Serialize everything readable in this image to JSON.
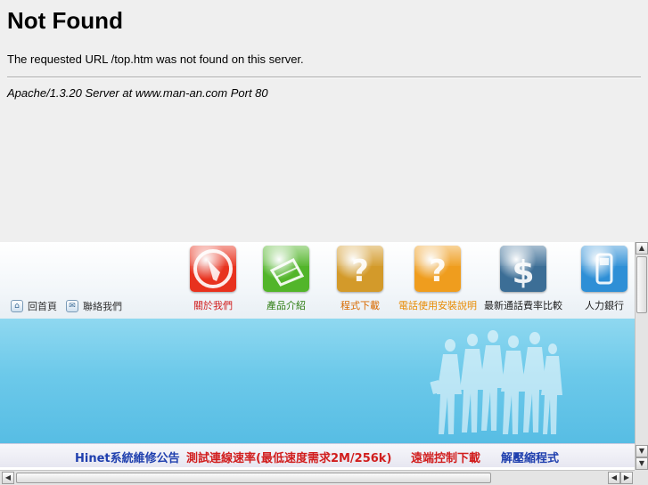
{
  "error_page": {
    "heading": "Not Found",
    "message": "The requested URL /top.htm was not found on this server.",
    "server_signature": "Apache/1.3.20 Server at www.man-an.com Port 80"
  },
  "site": {
    "home_links": [
      {
        "label": "回首頁",
        "icon": "home-icon"
      },
      {
        "label": "聯絡我們",
        "icon": "mail-icon"
      }
    ],
    "nav": [
      {
        "label": "關於我們",
        "color": "#d11e1e",
        "tile_color": "#e8321e",
        "icon": "red-tile-icon"
      },
      {
        "label": "產品介紹",
        "color": "#2e7d12",
        "tile_color": "#52b52a",
        "icon": "green-tile-icon"
      },
      {
        "label": "程式下載",
        "color": "#d86a00",
        "tile_color": "#d39a2a",
        "icon": "question-tile-icon"
      },
      {
        "label": "電話使用安裝說明",
        "color": "#e88a00",
        "tile_color": "#ef9d1e",
        "icon": "question-tile-icon"
      },
      {
        "label": "最新通話費率比較",
        "color": "#222222",
        "tile_color": "#3c6e96",
        "icon": "dollar-tile-icon"
      },
      {
        "label": "人力銀行",
        "color": "#222222",
        "tile_color": "#2e8fd6",
        "icon": "phone-tile-icon"
      }
    ],
    "ticker": [
      {
        "text": "Hinet系統維修公告",
        "color": "#1f3fae"
      },
      {
        "text": "測試連線速率(最低速度需求2M/256k)",
        "color": "#d11e1e"
      },
      {
        "text": "遠端控制下載",
        "color": "#d11e1e"
      },
      {
        "text": "解壓縮程式",
        "color": "#1f3fae"
      }
    ]
  }
}
